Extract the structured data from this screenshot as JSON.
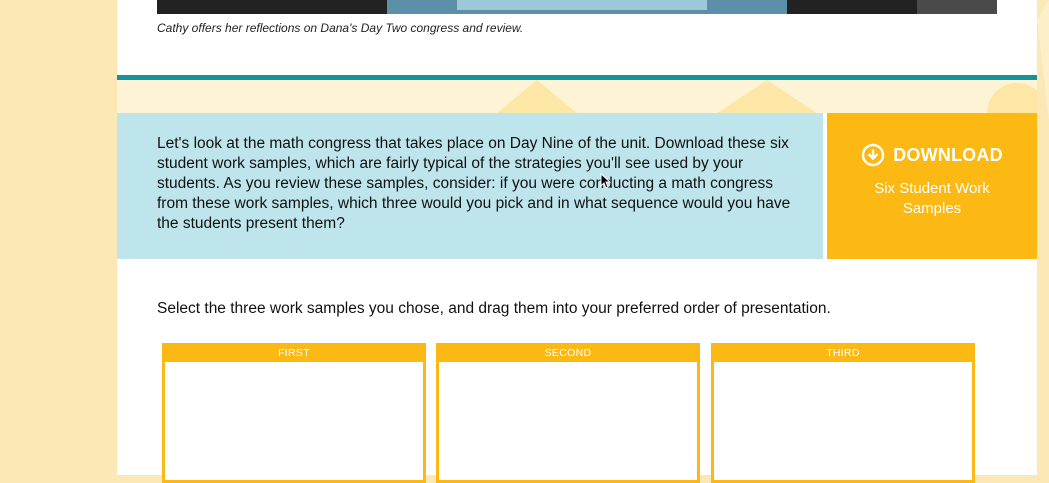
{
  "caption": "Cathy offers her reflections on Dana's Day Two congress and review.",
  "prompt_text": "Let's look at the math congress that takes place on Day Nine of the unit. Download these six student work samples, which are fairly typical of the strategies you'll see used by your students. As you review these samples, consider: if you were conducting a math congress from these work samples, which three would you pick and in what sequence would you have the students present them?",
  "download": {
    "title": "DOWNLOAD",
    "subtitle": "Six Student Work Samples",
    "icon": "download-circle-icon"
  },
  "instruction": "Select the three work samples you chose, and drag them into your preferred order of presentation.",
  "slots": [
    {
      "label": "FIRST"
    },
    {
      "label": "SECOND"
    },
    {
      "label": "THIRD"
    }
  ],
  "colors": {
    "teal": "#16939a",
    "prompt_bg": "#bde5eb",
    "accent": "#fcb813",
    "page_bg": "#fbe8b4"
  }
}
